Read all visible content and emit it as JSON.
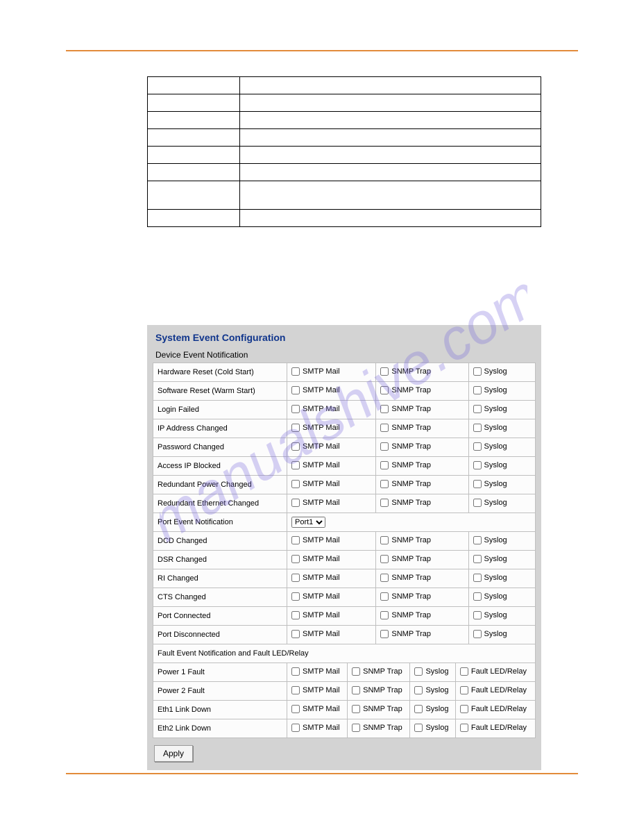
{
  "panel": {
    "title": "System Event Configuration",
    "deviceHeader": "Device Event Notification",
    "portHeader": "Port Event Notification",
    "faultHeader": "Fault Event Notification and Fault LED/Relay",
    "apply": "Apply",
    "portSelect": "Port1",
    "cols": {
      "smtp": "SMTP Mail",
      "snmp": "SNMP Trap",
      "syslog": "Syslog",
      "fault": "Fault LED/Relay"
    },
    "deviceEvents": [
      "Hardware Reset (Cold Start)",
      "Software Reset (Warm Start)",
      "Login Failed",
      "IP Address Changed",
      "Password Changed",
      "Access IP Blocked",
      "Redundant Power Changed",
      "Redundant Ethernet Changed"
    ],
    "portEvents": [
      "DCD Changed",
      "DSR Changed",
      "RI Changed",
      "CTS Changed",
      "Port Connected",
      "Port Disconnected"
    ],
    "faultEvents": [
      "Power 1 Fault",
      "Power 2 Fault",
      "Eth1 Link Down",
      "Eth2 Link Down"
    ]
  }
}
